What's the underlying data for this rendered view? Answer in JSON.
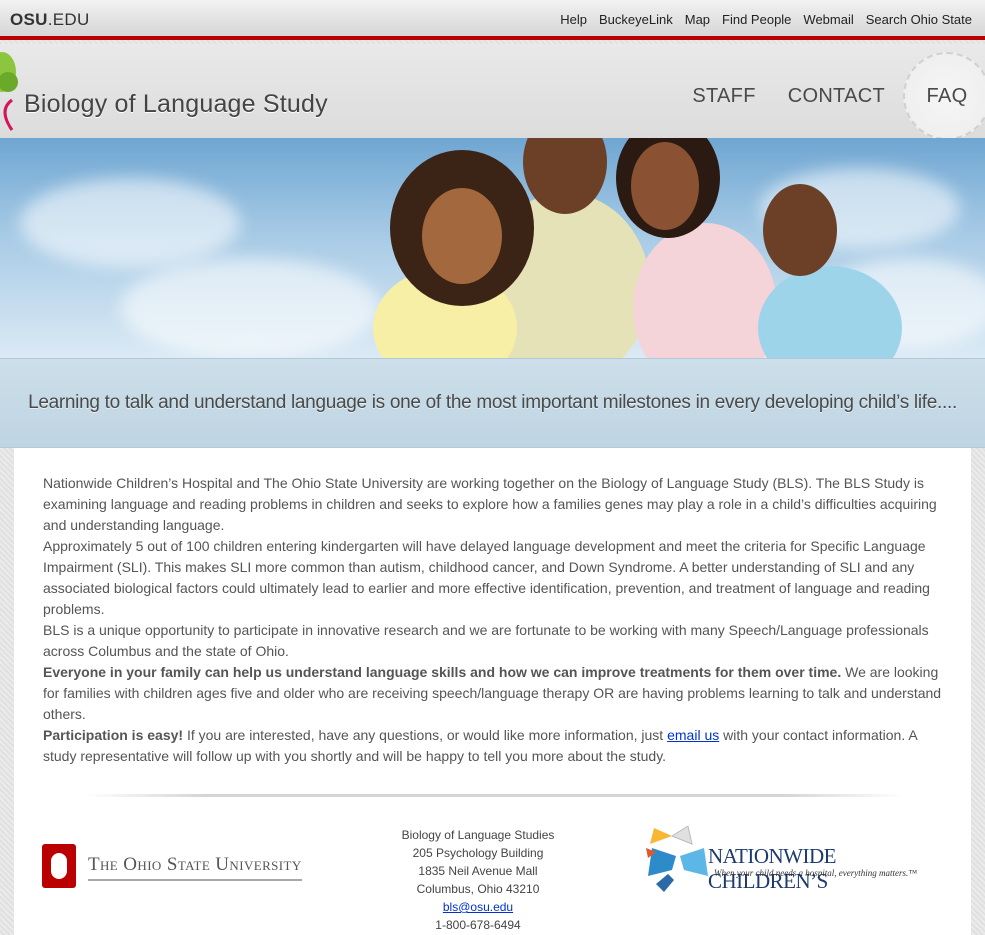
{
  "osu_bar": {
    "logo_bold": "OSU",
    "logo_rest": ".EDU",
    "links": [
      "Help",
      "BuckeyeLink",
      "Map",
      "Find People",
      "Webmail",
      "Search Ohio State"
    ]
  },
  "header": {
    "site_title": "Biology of Language Study",
    "nav": [
      "STAFF",
      "CONTACT",
      "FAQ"
    ]
  },
  "tagline": "Learning to talk and understand language is one of the most important milestones in every developing child’s life....",
  "body": {
    "p1": "Nationwide Children’s Hospital and The Ohio State University are working together on the Biology of Language Study (BLS).  The BLS Study is examining language and reading problems in children and seeks to explore how a families genes may play a role in a child’s difficulties acquiring and understanding language.",
    "p2": "Approximately 5 out of 100 children entering kindergarten will have delayed language development and meet the criteria for Specific Language Impairment (SLI).  This makes SLI more common than autism, childhood cancer, and Down Syndrome.  A better understanding of SLI and any associated biological factors could ultimately lead to earlier and more effective identification, prevention, and treatment of language and reading problems.",
    "p3": "BLS is a unique opportunity to participate in innovative research and we are fortunate to be working with many Speech/Language professionals across Columbus and the state of Ohio.",
    "p4_bold": "Everyone in your family can help us understand language skills and how we can improve treatments for them over time.",
    "p4_rest": " We are looking for families with children ages five and older who are receiving speech/language therapy OR are having problems learning to talk and understand others.",
    "p5_bold": "Participation is easy!",
    "p5_pre": " If you are interested, have any questions, or would like more information, just ",
    "p5_link": "email us",
    "p5_post": " with your contact information. A study representative will follow up with you shortly and will be happy to tell you more about the study."
  },
  "footer": {
    "osu_name": "The Ohio State University",
    "address": [
      "Biology of Language Studies",
      "205 Psychology Building",
      "1835 Neil Avenue Mall",
      "Columbus, Ohio 43210"
    ],
    "email": "bls@osu.edu",
    "phone": "1-800-678-6494",
    "nch_name": "NATIONWIDE CHILDREN’S",
    "nch_tagline": "When your child needs a hospital, everything matters.™"
  },
  "colors": {
    "osu_red": "#bb0000",
    "link_blue": "#0033cc",
    "nch_blue": "#1c3a6e"
  }
}
